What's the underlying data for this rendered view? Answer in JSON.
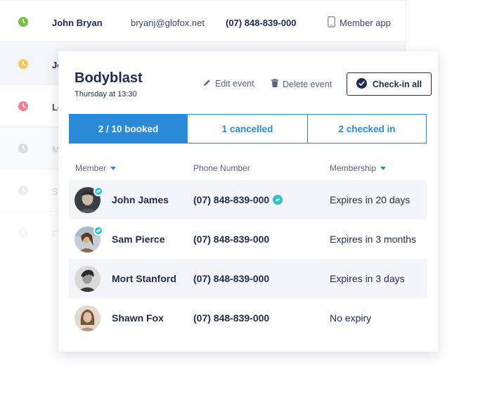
{
  "background_list": {
    "rows": [
      {
        "status_color": "#7ac142",
        "name": "John Bryan",
        "email": "bryanj@glofox.net",
        "phone": "(07) 848-839-000",
        "device_label": "Member app"
      },
      {
        "status_color": "#f5c862",
        "initial": "Jo"
      },
      {
        "status_color": "#ef6b7d",
        "initial": "Le"
      },
      {
        "status_color": "#b9bfcc",
        "initial": "M"
      },
      {
        "status_color": "#c8ccd6",
        "initial": "Sl"
      },
      {
        "status_color": "#d4d7df",
        "initial": "F"
      }
    ]
  },
  "event": {
    "title": "Bodyblast",
    "subtitle": "Thursday at 13:30",
    "actions": {
      "edit_label": "Edit event",
      "delete_label": "Delete event",
      "checkin_all_label": "Check-in all"
    },
    "tabs": [
      {
        "label": "2 / 10 booked",
        "active": true
      },
      {
        "label": "1 cancelled",
        "active": false
      },
      {
        "label": "2 checked in",
        "active": false
      }
    ],
    "columns": {
      "member": "Member",
      "phone": "Phone Number",
      "membership": "Membership"
    },
    "members": [
      {
        "name": "John James",
        "phone": "(07) 848-839-000",
        "membership": "Expires in 20 days",
        "avatar_icon": "avatar-man-dark-icon",
        "linked": true,
        "phone_linked": true
      },
      {
        "name": "Sam Pierce",
        "phone": "(07) 848-839-000",
        "membership": "Expires in 3 months",
        "avatar_icon": "avatar-woman-outdoor-icon",
        "linked": true,
        "phone_linked": false
      },
      {
        "name": "Mort Stanford",
        "phone": "(07) 848-839-000",
        "membership": "Expires in 3 days",
        "avatar_icon": "avatar-man-bw-icon",
        "linked": false,
        "phone_linked": false
      },
      {
        "name": "Shawn Fox",
        "phone": "(07) 848-839-000",
        "membership": "No expiry",
        "avatar_icon": "avatar-woman-brown-icon",
        "linked": false,
        "phone_linked": false
      }
    ]
  },
  "colors": {
    "accent": "#2b8ad8",
    "navy": "#1f2b4d",
    "link_badge": "#2ec4c4"
  }
}
